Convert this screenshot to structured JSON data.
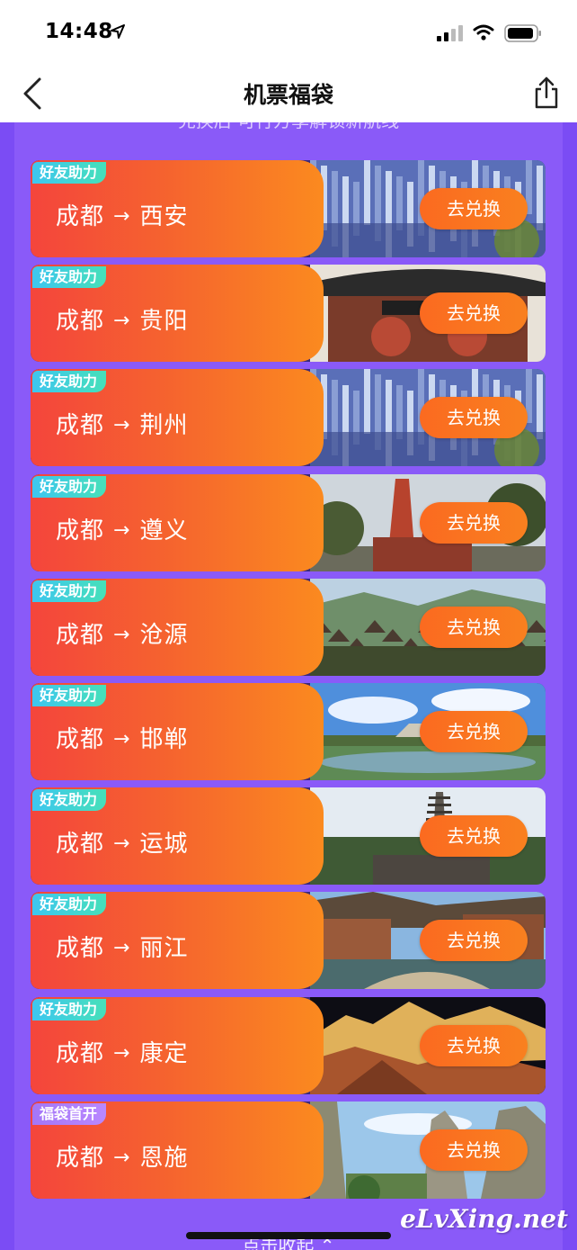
{
  "status_bar": {
    "time": "14:48"
  },
  "nav": {
    "title": "机票福袋"
  },
  "top_hint": "兑换后 可行方享解锁新航线",
  "cards": [
    {
      "badge": "好友助力",
      "badge_type": "friend",
      "from": "成都",
      "arrow": "→",
      "to": "西安",
      "button": "去兑换",
      "photo": "rock-cliff"
    },
    {
      "badge": "好友助力",
      "badge_type": "friend",
      "from": "成都",
      "arrow": "→",
      "to": "贵阳",
      "button": "去兑换",
      "photo": "pavilion"
    },
    {
      "badge": "好友助力",
      "badge_type": "friend",
      "from": "成都",
      "arrow": "→",
      "to": "荆州",
      "button": "去兑换",
      "photo": "rock-cliff"
    },
    {
      "badge": "好友助力",
      "badge_type": "friend",
      "from": "成都",
      "arrow": "→",
      "to": "遵义",
      "button": "去兑换",
      "photo": "monument"
    },
    {
      "badge": "好友助力",
      "badge_type": "friend",
      "from": "成都",
      "arrow": "→",
      "to": "沧源",
      "button": "去兑换",
      "photo": "village"
    },
    {
      "badge": "好友助力",
      "badge_type": "friend",
      "from": "成都",
      "arrow": "→",
      "to": "邯郸",
      "button": "去兑换",
      "photo": "lake-sky"
    },
    {
      "badge": "好友助力",
      "badge_type": "friend",
      "from": "成都",
      "arrow": "→",
      "to": "运城",
      "button": "去兑换",
      "photo": "pagoda"
    },
    {
      "badge": "好友助力",
      "badge_type": "friend",
      "from": "成都",
      "arrow": "→",
      "to": "丽江",
      "button": "去兑换",
      "photo": "old-town"
    },
    {
      "badge": "好友助力",
      "badge_type": "friend",
      "from": "成都",
      "arrow": "→",
      "to": "康定",
      "button": "去兑换",
      "photo": "snow-mountain"
    },
    {
      "badge": "福袋首开",
      "badge_type": "new",
      "from": "成都",
      "arrow": "→",
      "to": "恩施",
      "button": "去兑换",
      "photo": "canyon"
    }
  ],
  "collapse_label": "点击收起",
  "watermark": "eLvXing.net",
  "colors": {
    "content_bg": "#7b4cf4",
    "card_gradient_start": "#f4453c",
    "card_gradient_end": "#fb8a1f",
    "badge_friend": "#3ec6f0",
    "badge_new": "#a476f7",
    "button": "#fb6a20"
  }
}
